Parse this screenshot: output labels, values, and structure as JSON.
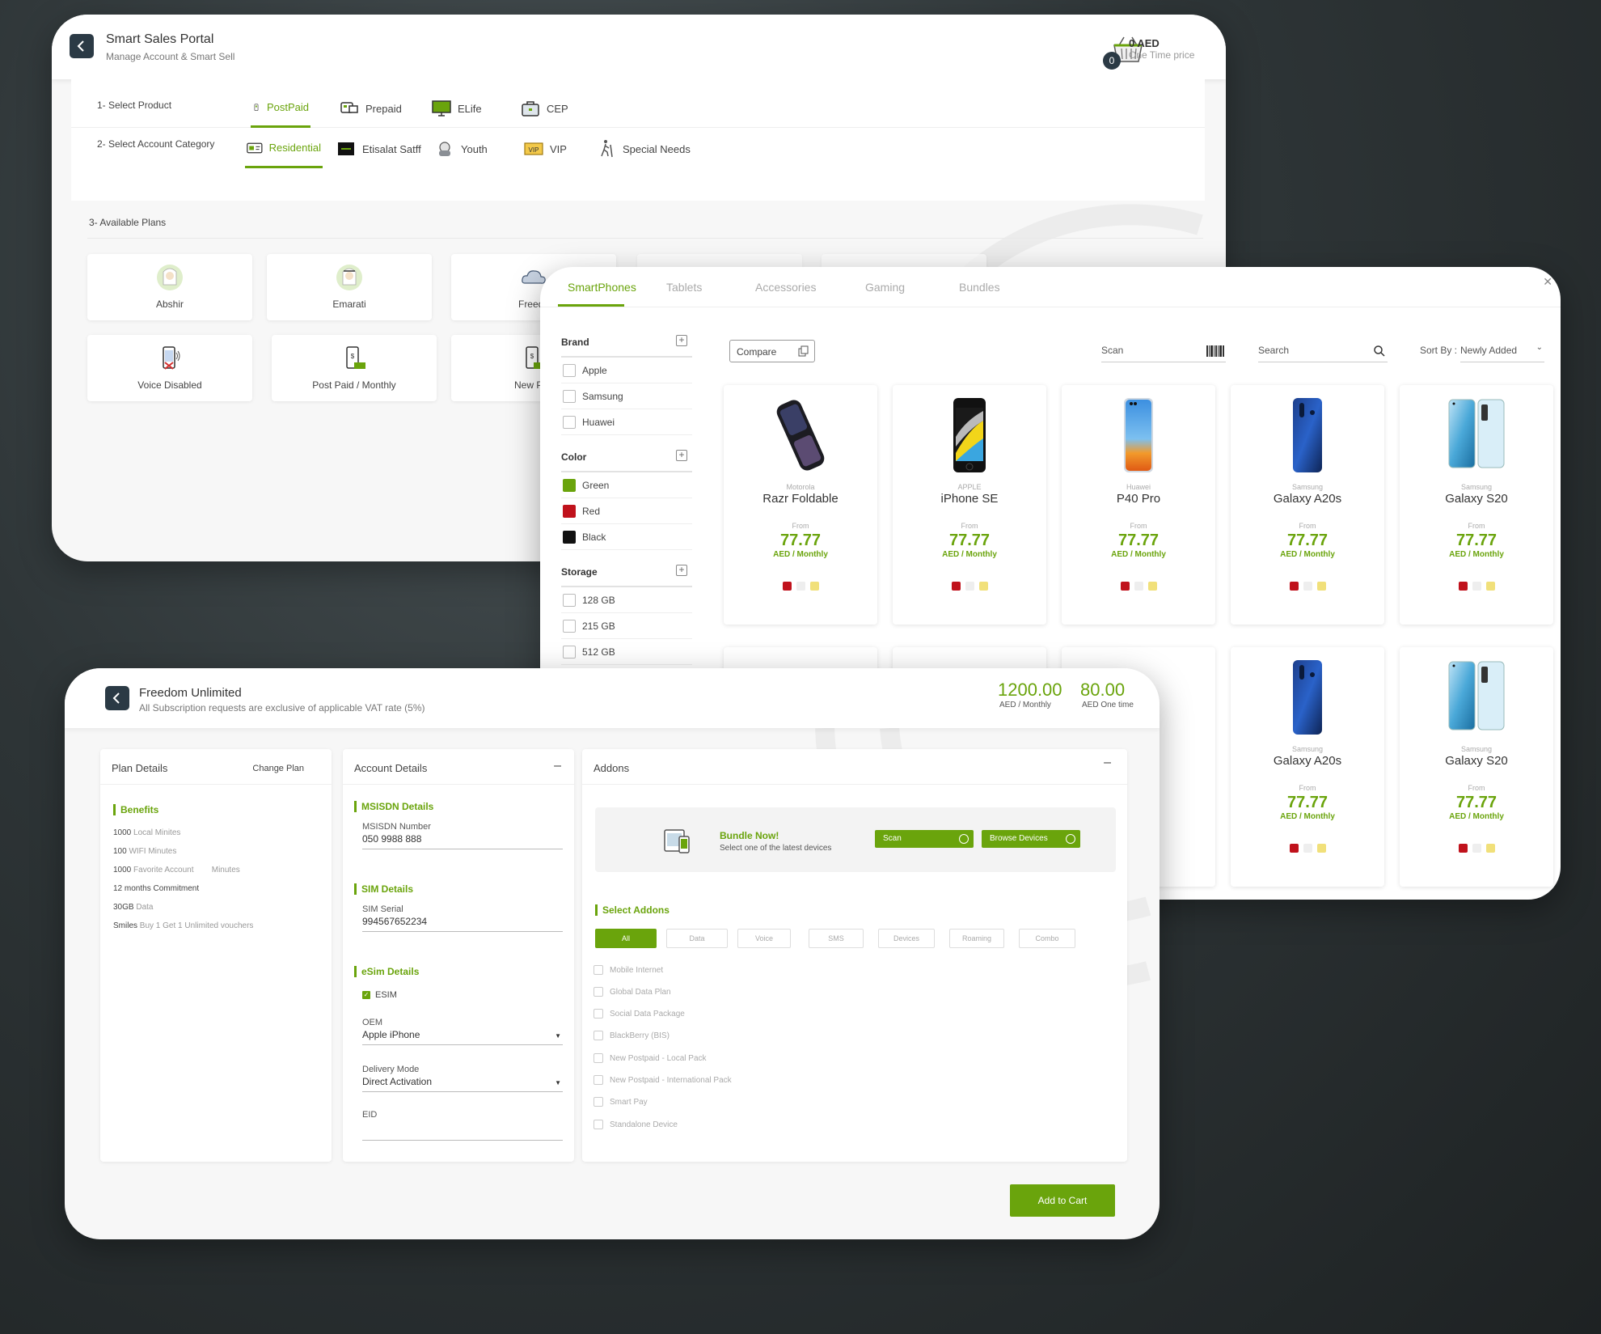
{
  "portal": {
    "title": "Smart Sales Portal",
    "subtitle": "Manage Account & Smart Sell",
    "cart_count": "0",
    "cart_amount": "0 AED",
    "cart_label": "One Time price",
    "step1_label": "1- Select Product",
    "products": [
      {
        "label": "PostPaid",
        "icon": "postpaid-phone-icon",
        "active": true
      },
      {
        "label": "Prepaid",
        "icon": "prepaid-card-icon",
        "active": false
      },
      {
        "label": "ELife",
        "icon": "monitor-icon",
        "active": false
      },
      {
        "label": "CEP",
        "icon": "briefcase-icon",
        "active": false
      }
    ],
    "step2_label": "2- Select Account Category",
    "categories": [
      {
        "label": "Residential",
        "icon": "id-card-icon",
        "active": true
      },
      {
        "label": "Etisalat Satff",
        "icon": "etisalat-badge-icon",
        "active": false
      },
      {
        "label": "Youth",
        "icon": "youth-icon",
        "active": false
      },
      {
        "label": "VIP",
        "icon": "vip-badge-icon",
        "active": false
      },
      {
        "label": "Special Needs",
        "icon": "special-needs-icon",
        "active": false
      }
    ],
    "step3_label": "3- Available Plans",
    "plans": [
      "Abshir",
      "Emarati",
      "Freedo",
      "Voice Disabled",
      "Post Paid / Monthly",
      "New Pos"
    ]
  },
  "devices": {
    "tabs": [
      "SmartPhones",
      "Tablets",
      "Accessories",
      "Gaming",
      "Bundles"
    ],
    "filters": {
      "brand": {
        "title": "Brand",
        "items": [
          "Apple",
          "Samsung",
          "Huawei"
        ]
      },
      "color": {
        "title": "Color",
        "items": [
          {
            "label": "Green",
            "hex": "#6aa40c"
          },
          {
            "label": "Red",
            "hex": "#c0121c"
          },
          {
            "label": "Black",
            "hex": "#111111"
          }
        ]
      },
      "storage": {
        "title": "Storage",
        "items": [
          "128 GB",
          "215 GB",
          "512 GB"
        ]
      }
    },
    "compare_label": "Compare",
    "scan_label": "Scan",
    "search_label": "Search",
    "sort_label": "Sort By :",
    "sort_value": "Newly Added",
    "from_label": "From",
    "per_label": "AED / Monthly",
    "cards": [
      {
        "brand": "Motorola",
        "name": "Razr Foldable",
        "price": "77.77",
        "phone": "razr"
      },
      {
        "brand": "APPLE",
        "name": "iPhone SE",
        "price": "77.77",
        "phone": "iphone"
      },
      {
        "brand": "Huawei",
        "name": "P40 Pro",
        "price": "77.77",
        "phone": "p40"
      },
      {
        "brand": "Samsung",
        "name": "Galaxy A20s",
        "price": "77.77",
        "phone": "a20"
      },
      {
        "brand": "Samsung",
        "name": "Galaxy S20",
        "price": "77.77",
        "phone": "s20"
      },
      {
        "brand": "Samsung",
        "name": "Galaxy A20s",
        "price": "77.77",
        "phone": "a20"
      },
      {
        "brand": "Samsung",
        "name": "Galaxy S20",
        "price": "77.77",
        "phone": "s20"
      }
    ],
    "swatches": [
      "#c0121c",
      "#eeeeee",
      "#f1e07a"
    ]
  },
  "plan": {
    "title": "Freedom Unlimited",
    "subtitle": "All Subscription requests are exclusive of applicable VAT rate (5%)",
    "monthly_amount": "1200.00",
    "monthly_label": "AED / Monthly",
    "onetime_amount": "80.00",
    "onetime_label": "AED One time",
    "details_title": "Plan Details",
    "change_plan": "Change Plan",
    "benefits_title": "Benefits",
    "benefits": [
      {
        "v": "1000",
        "t": "Local Minites"
      },
      {
        "v": "100",
        "t": "WIFI Minutes"
      },
      {
        "v": "1000",
        "t": "Favorite Account        Minutes"
      },
      {
        "v": "12 months Commitment",
        "t": ""
      },
      {
        "v": "30GB",
        "t": "Data"
      },
      {
        "v": "Smiles",
        "t": "Buy 1 Get 1 Unlimited vouchers"
      }
    ],
    "account_title": "Account Details",
    "msisdn_title": "MSISDN Details",
    "msisdn_label": "MSISDN Number",
    "msisdn_value": "050 9988 888",
    "sim_title": "SIM Details",
    "sim_label": "SIM Serial",
    "sim_value": "994567652234",
    "esim_title": "eSim Details",
    "esim_check": "ESIM",
    "oem_label": "OEM",
    "oem_value": "Apple iPhone",
    "delivery_label": "Delivery Mode",
    "delivery_value": "Direct Activation",
    "eid_label": "EID",
    "addons_title": "Addons",
    "bundle_title": "Bundle Now!",
    "bundle_sub": "Select one of the latest devices",
    "scan_btn": "Scan",
    "browse_btn": "Browse Devices",
    "select_addons": "Select Addons",
    "addon_filters": [
      "All",
      "Data",
      "Voice",
      "SMS",
      "Devices",
      "Roaming",
      "Combo"
    ],
    "addons": [
      "Mobile Internet",
      "Global Data Plan",
      "Social Data Package",
      "BlackBerry (BIS)",
      "New Postpaid - Local Pack",
      "New Postpaid - International Pack",
      "Smart Pay",
      "Standalone Device"
    ],
    "add_cart": "Add to Cart"
  }
}
